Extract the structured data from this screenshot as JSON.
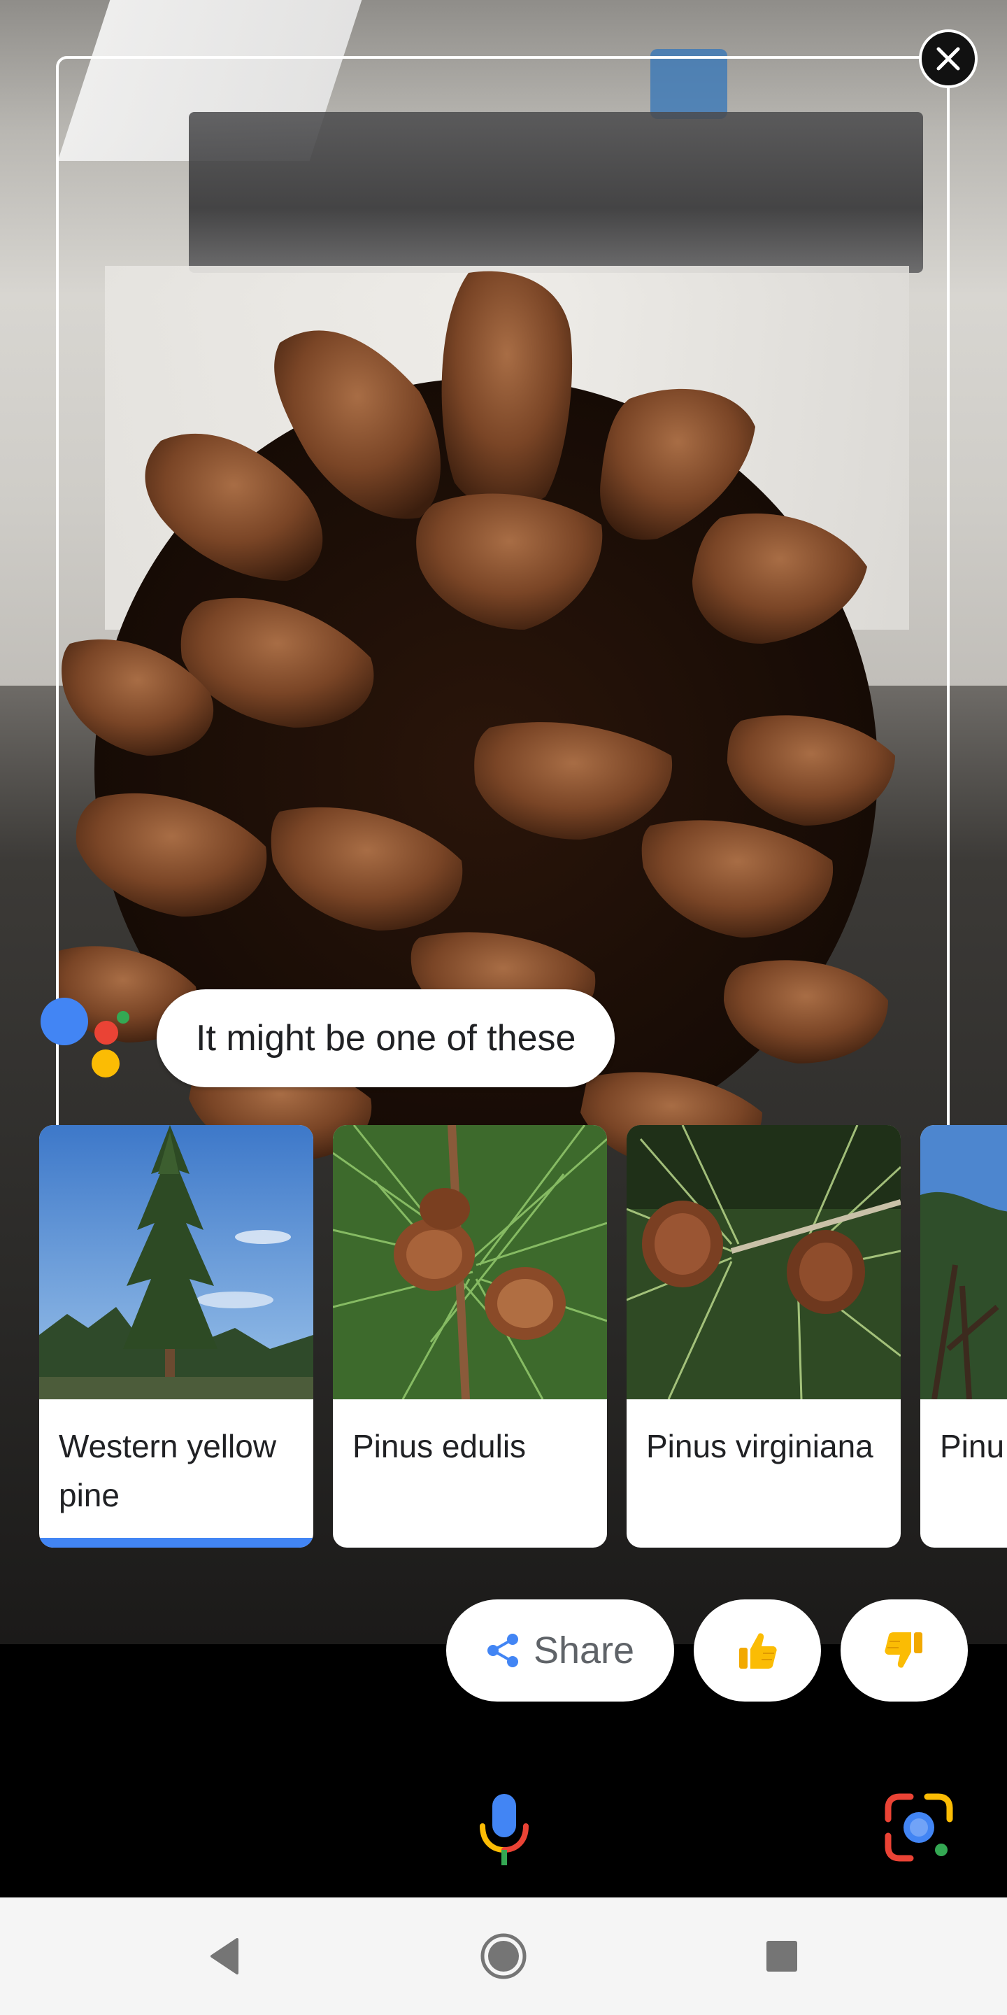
{
  "assistant": {
    "message": "It might be one of these",
    "colors": {
      "blue": "#4285f4",
      "red": "#ea4335",
      "yellow": "#fbbc04",
      "green": "#34a853"
    }
  },
  "results": [
    {
      "label": "Western yellow pine",
      "selected": true,
      "image": "tall-pine-tree"
    },
    {
      "label": "Pinus edulis",
      "selected": false,
      "image": "pine-cones-on-branch"
    },
    {
      "label": "Pinus virginiana",
      "selected": false,
      "image": "pine-cones-on-needles"
    },
    {
      "label": "Pinu",
      "selected": false,
      "image": "pine-tree-partial"
    }
  ],
  "actions": {
    "share_label": "Share",
    "thumbs_up_icon": "thumbs-up-icon",
    "thumbs_down_icon": "thumbs-down-icon"
  },
  "bottom_bar": {
    "mic_icon": "microphone-icon",
    "lens_icon": "google-lens-icon"
  },
  "nav": {
    "back_icon": "back-triangle-icon",
    "home_icon": "home-circle-icon",
    "recents_icon": "recents-square-icon"
  }
}
